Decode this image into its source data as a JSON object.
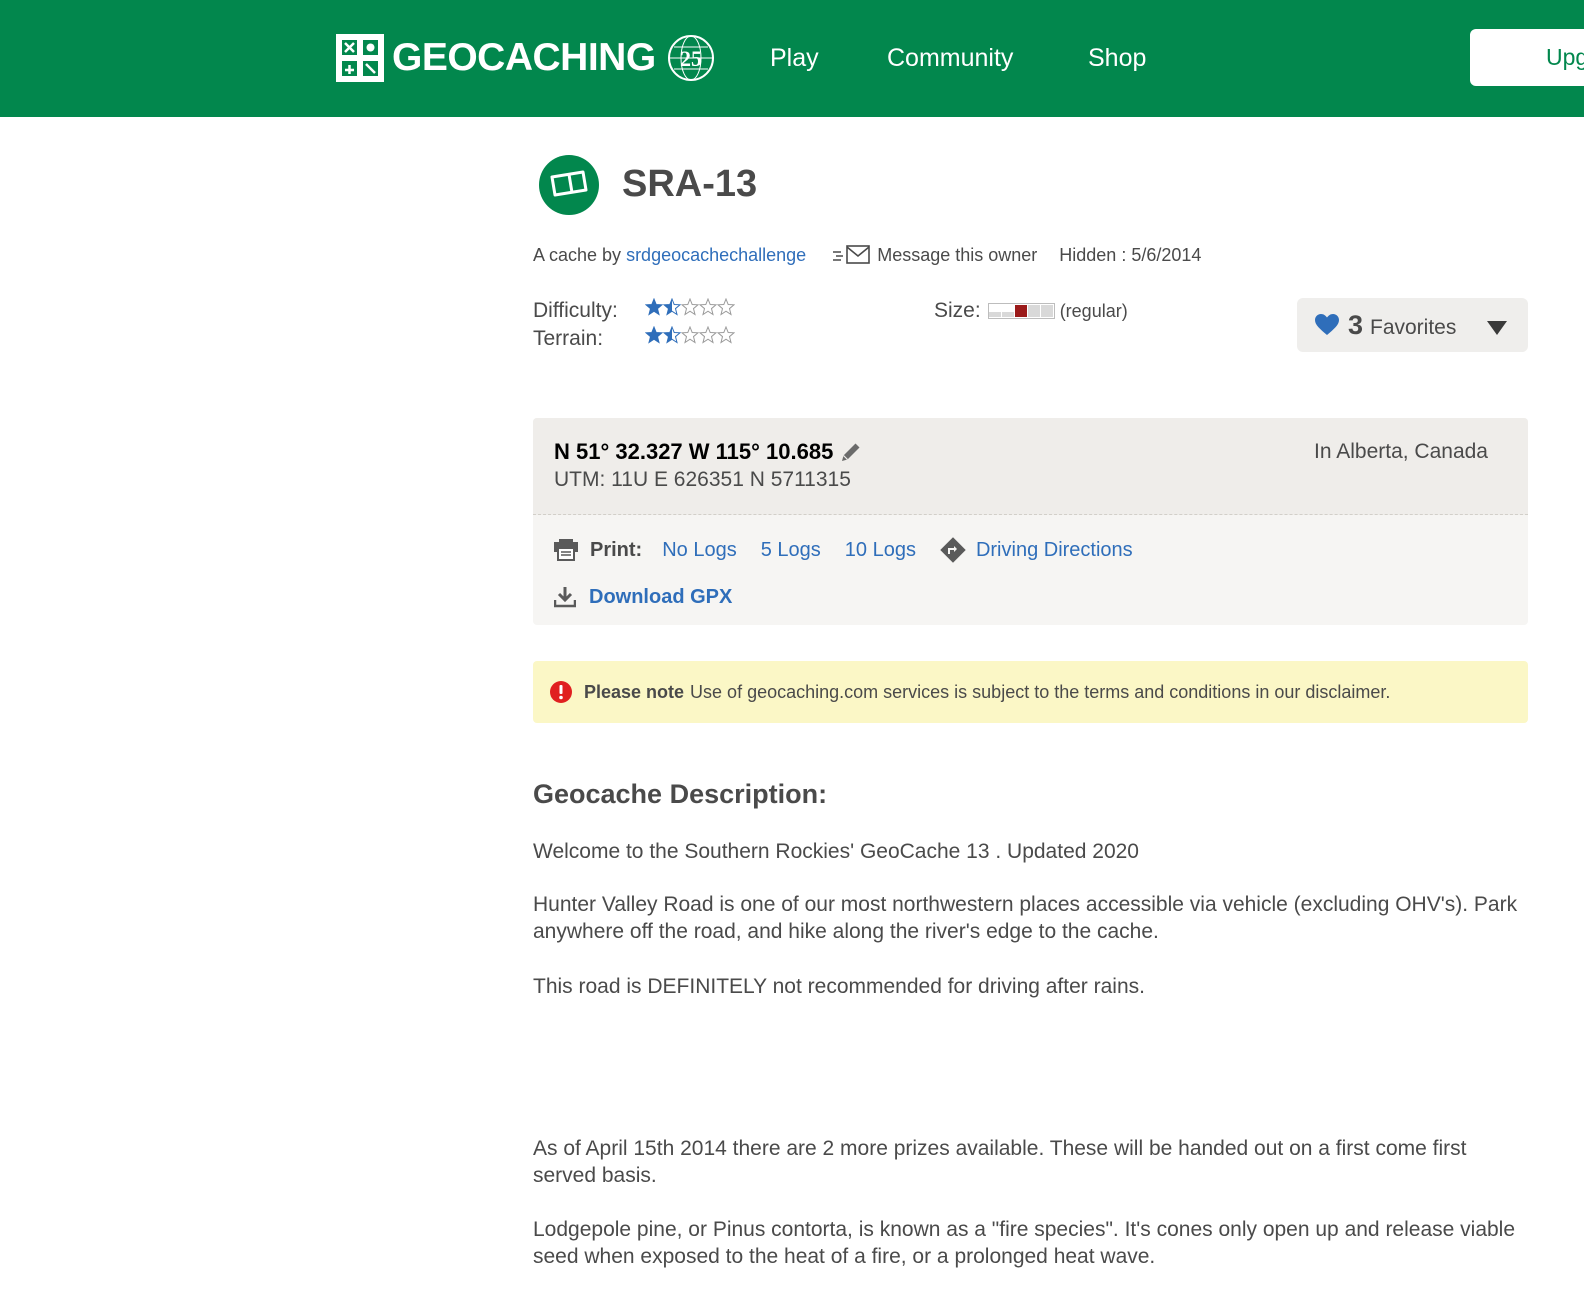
{
  "header": {
    "brand": "GEOCACHING",
    "badge_text": "25",
    "nav": [
      "Play",
      "Community",
      "Shop"
    ],
    "cta_label": "Upgrade",
    "bg_color": "#02874d"
  },
  "cache": {
    "title": "SRA-13",
    "type_icon": "traditional-cache-icon",
    "by_prefix": "A cache by",
    "owner": "srdgeocachechallenge",
    "message_label": "Message this owner",
    "hidden_label": "Hidden : 5/6/2014",
    "difficulty_label": "Difficulty:",
    "terrain_label": "Terrain:",
    "difficulty": 1.5,
    "terrain": 1.5,
    "max_stars": 5,
    "size_label": "Size:",
    "size_text": "(regular)",
    "favorites": {
      "count": "3",
      "label": "Favorites"
    }
  },
  "coords": {
    "text": "N 51° 32.327 W 115° 10.685",
    "utm": "UTM: 11U E 626351 N 5711315",
    "location": "In Alberta, Canada",
    "print_label": "Print:",
    "print_links": [
      "No Logs",
      "5 Logs",
      "10 Logs"
    ],
    "directions": "Driving Directions",
    "gpx": "Download GPX"
  },
  "notice": {
    "title": "Please note",
    "text": "Use of geocaching.com services is subject to the terms and conditions in our disclaimer."
  },
  "description": {
    "heading": "Geocache Description:",
    "paragraphs": [
      "Welcome to the Southern Rockies' GeoCache 13 . Updated 2020",
      "Hunter Valley Road is one of our most northwestern places accessible via vehicle (excluding OHV's). Park anywhere off the road, and hike along the river's edge to the cache.",
      "This road is DEFINITELY not recommended for driving after rains.",
      "As of April 15th 2014 there are 2 more prizes available. These will be handed out on a first come first served basis.",
      "Lodgepole pine, or Pinus contorta, is known as a \"fire species\".  It's cones only open up and release viable seed when exposed to the heat of a fire, or a prolonged heat wave."
    ]
  },
  "colors": {
    "link": "#2f6eba",
    "star": "#2f6eba",
    "notice_bg": "#fbf7c6",
    "alert": "#e02020"
  }
}
